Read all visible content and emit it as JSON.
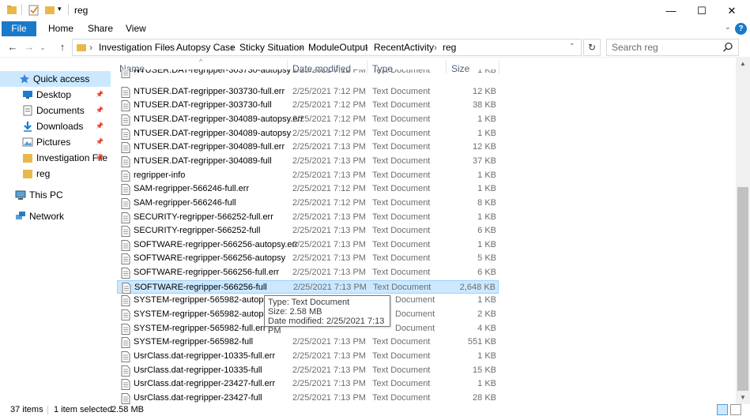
{
  "window": {
    "title": "reg",
    "controls": {
      "minimize": "—",
      "maximize": "☐",
      "close": "✕"
    }
  },
  "ribbon": {
    "tabs": [
      "File",
      "Home",
      "Share",
      "View"
    ],
    "help": "?",
    "expand": "⌄"
  },
  "address": {
    "breadcrumb": [
      "Investigation Files",
      "Autopsy Case",
      "Sticky Situation",
      "ModuleOutput",
      "RecentActivity",
      "reg"
    ],
    "separator": "›",
    "search_placeholder": "Search reg"
  },
  "nav": {
    "back": "←",
    "forward": "→",
    "up": "↑",
    "recent": "⌄",
    "refresh": "↻"
  },
  "navpane": {
    "items": [
      {
        "label": "Quick access",
        "icon": "star-icon",
        "selected": true,
        "pinned": false
      },
      {
        "label": "Desktop",
        "icon": "desktop-icon",
        "selected": false,
        "pinned": true
      },
      {
        "label": "Documents",
        "icon": "documents-icon",
        "selected": false,
        "pinned": true
      },
      {
        "label": "Downloads",
        "icon": "download-icon",
        "selected": false,
        "pinned": true
      },
      {
        "label": "Pictures",
        "icon": "pictures-icon",
        "selected": false,
        "pinned": true
      },
      {
        "label": "Investigation File",
        "icon": "folder-icon",
        "selected": false,
        "pinned": true
      },
      {
        "label": "reg",
        "icon": "folder-icon",
        "selected": false,
        "pinned": false
      },
      {
        "label": "This PC",
        "icon": "computer-icon",
        "selected": false,
        "pinned": false
      },
      {
        "label": "Network",
        "icon": "network-icon",
        "selected": false,
        "pinned": false
      }
    ]
  },
  "filelist": {
    "columns": {
      "name": "Name",
      "date": "Date modified",
      "type": "Type",
      "size": "Size"
    },
    "files": [
      {
        "name": "NTUSER.DAT-regripper-303730-autopsy",
        "date": "2/25/2021 7:12 PM",
        "type": "Text Document",
        "size": "1 KB"
      },
      {
        "name": "NTUSER.DAT-regripper-303730-full.err",
        "date": "2/25/2021 7:12 PM",
        "type": "Text Document",
        "size": "12 KB"
      },
      {
        "name": "NTUSER.DAT-regripper-303730-full",
        "date": "2/25/2021 7:12 PM",
        "type": "Text Document",
        "size": "38 KB"
      },
      {
        "name": "NTUSER.DAT-regripper-304089-autopsy.err",
        "date": "2/25/2021 7:12 PM",
        "type": "Text Document",
        "size": "1 KB"
      },
      {
        "name": "NTUSER.DAT-regripper-304089-autopsy",
        "date": "2/25/2021 7:12 PM",
        "type": "Text Document",
        "size": "1 KB"
      },
      {
        "name": "NTUSER.DAT-regripper-304089-full.err",
        "date": "2/25/2021 7:13 PM",
        "type": "Text Document",
        "size": "12 KB"
      },
      {
        "name": "NTUSER.DAT-regripper-304089-full",
        "date": "2/25/2021 7:13 PM",
        "type": "Text Document",
        "size": "37 KB"
      },
      {
        "name": "regripper-info",
        "date": "2/25/2021 7:13 PM",
        "type": "Text Document",
        "size": "1 KB"
      },
      {
        "name": "SAM-regripper-566246-full.err",
        "date": "2/25/2021 7:12 PM",
        "type": "Text Document",
        "size": "1 KB"
      },
      {
        "name": "SAM-regripper-566246-full",
        "date": "2/25/2021 7:12 PM",
        "type": "Text Document",
        "size": "8 KB"
      },
      {
        "name": "SECURITY-regripper-566252-full.err",
        "date": "2/25/2021 7:13 PM",
        "type": "Text Document",
        "size": "1 KB"
      },
      {
        "name": "SECURITY-regripper-566252-full",
        "date": "2/25/2021 7:13 PM",
        "type": "Text Document",
        "size": "6 KB"
      },
      {
        "name": "SOFTWARE-regripper-566256-autopsy.err",
        "date": "2/25/2021 7:13 PM",
        "type": "Text Document",
        "size": "1 KB"
      },
      {
        "name": "SOFTWARE-regripper-566256-autopsy",
        "date": "2/25/2021 7:13 PM",
        "type": "Text Document",
        "size": "5 KB"
      },
      {
        "name": "SOFTWARE-regripper-566256-full.err",
        "date": "2/25/2021 7:13 PM",
        "type": "Text Document",
        "size": "6 KB"
      },
      {
        "name": "SOFTWARE-regripper-566256-full",
        "date": "2/25/2021 7:13 PM",
        "type": "Text Document",
        "size": "2,648 KB"
      },
      {
        "name": "SYSTEM-regripper-565982-autopsy.err",
        "date": "",
        "type": "Document",
        "size": "1 KB"
      },
      {
        "name": "SYSTEM-regripper-565982-autopsy",
        "date": "",
        "type": "Document",
        "size": "2 KB"
      },
      {
        "name": "SYSTEM-regripper-565982-full.err",
        "date": "",
        "type": "Document",
        "size": "4 KB"
      },
      {
        "name": "SYSTEM-regripper-565982-full",
        "date": "2/25/2021 7:13 PM",
        "type": "Text Document",
        "size": "551 KB"
      },
      {
        "name": "UsrClass.dat-regripper-10335-full.err",
        "date": "2/25/2021 7:13 PM",
        "type": "Text Document",
        "size": "1 KB"
      },
      {
        "name": "UsrClass.dat-regripper-10335-full",
        "date": "2/25/2021 7:13 PM",
        "type": "Text Document",
        "size": "15 KB"
      },
      {
        "name": "UsrClass.dat-regripper-23427-full.err",
        "date": "2/25/2021 7:13 PM",
        "type": "Text Document",
        "size": "1 KB"
      },
      {
        "name": "UsrClass.dat-regripper-23427-full",
        "date": "2/25/2021 7:13 PM",
        "type": "Text Document",
        "size": "28 KB"
      }
    ],
    "selected_index": 15
  },
  "tooltip": {
    "type": "Type: Text Document",
    "size": "Size: 2.58 MB",
    "modified": "Date modified: 2/25/2021 7:13 PM"
  },
  "status": {
    "count": "37 items",
    "selection": "1 item selected",
    "size": "2.58 MB"
  },
  "colors": {
    "accent": "#1979ca",
    "selection": "#cce8ff",
    "folder": "#e8b94a"
  }
}
